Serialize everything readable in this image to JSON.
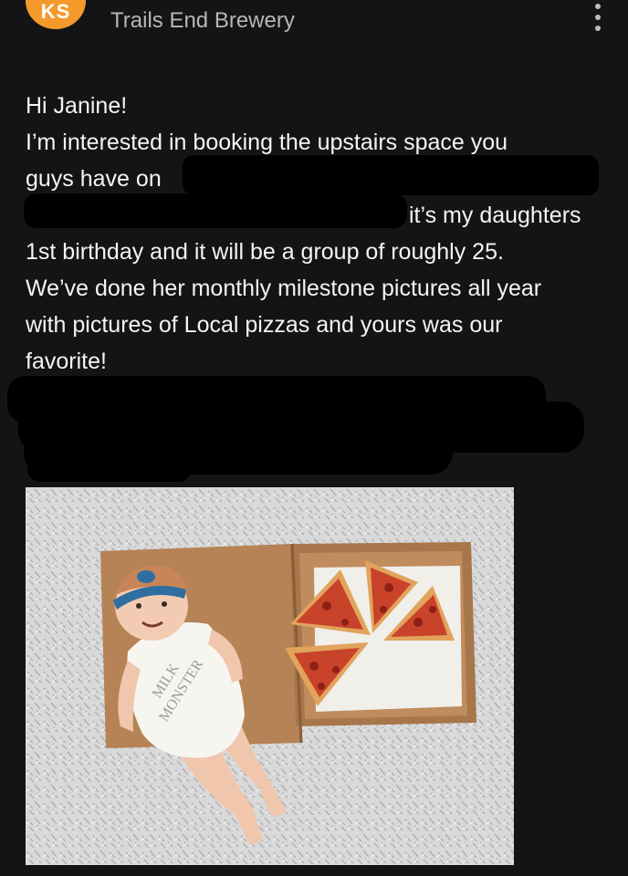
{
  "header": {
    "avatar_initials": "KS",
    "sender_name": "Trails End Brewery",
    "more_icon": "more-vertical-icon"
  },
  "message": {
    "lines": [
      "Hi Janine!",
      "I’m interested in booking the upstairs space you",
      "guys have on",
      "it’s my daughters",
      "1st birthday and it will be a group of roughly 25.",
      "We’ve done her monthly milestone pictures all year",
      "with pictures of Local pizzas and yours was our",
      "favorite!"
    ]
  },
  "photo": {
    "onesie_text": [
      "MILK",
      "MONSTER"
    ]
  },
  "colors": {
    "background": "#141414",
    "avatar": "#f49a2c",
    "text": "#f4f4f4",
    "sender": "#b7b7b7"
  }
}
